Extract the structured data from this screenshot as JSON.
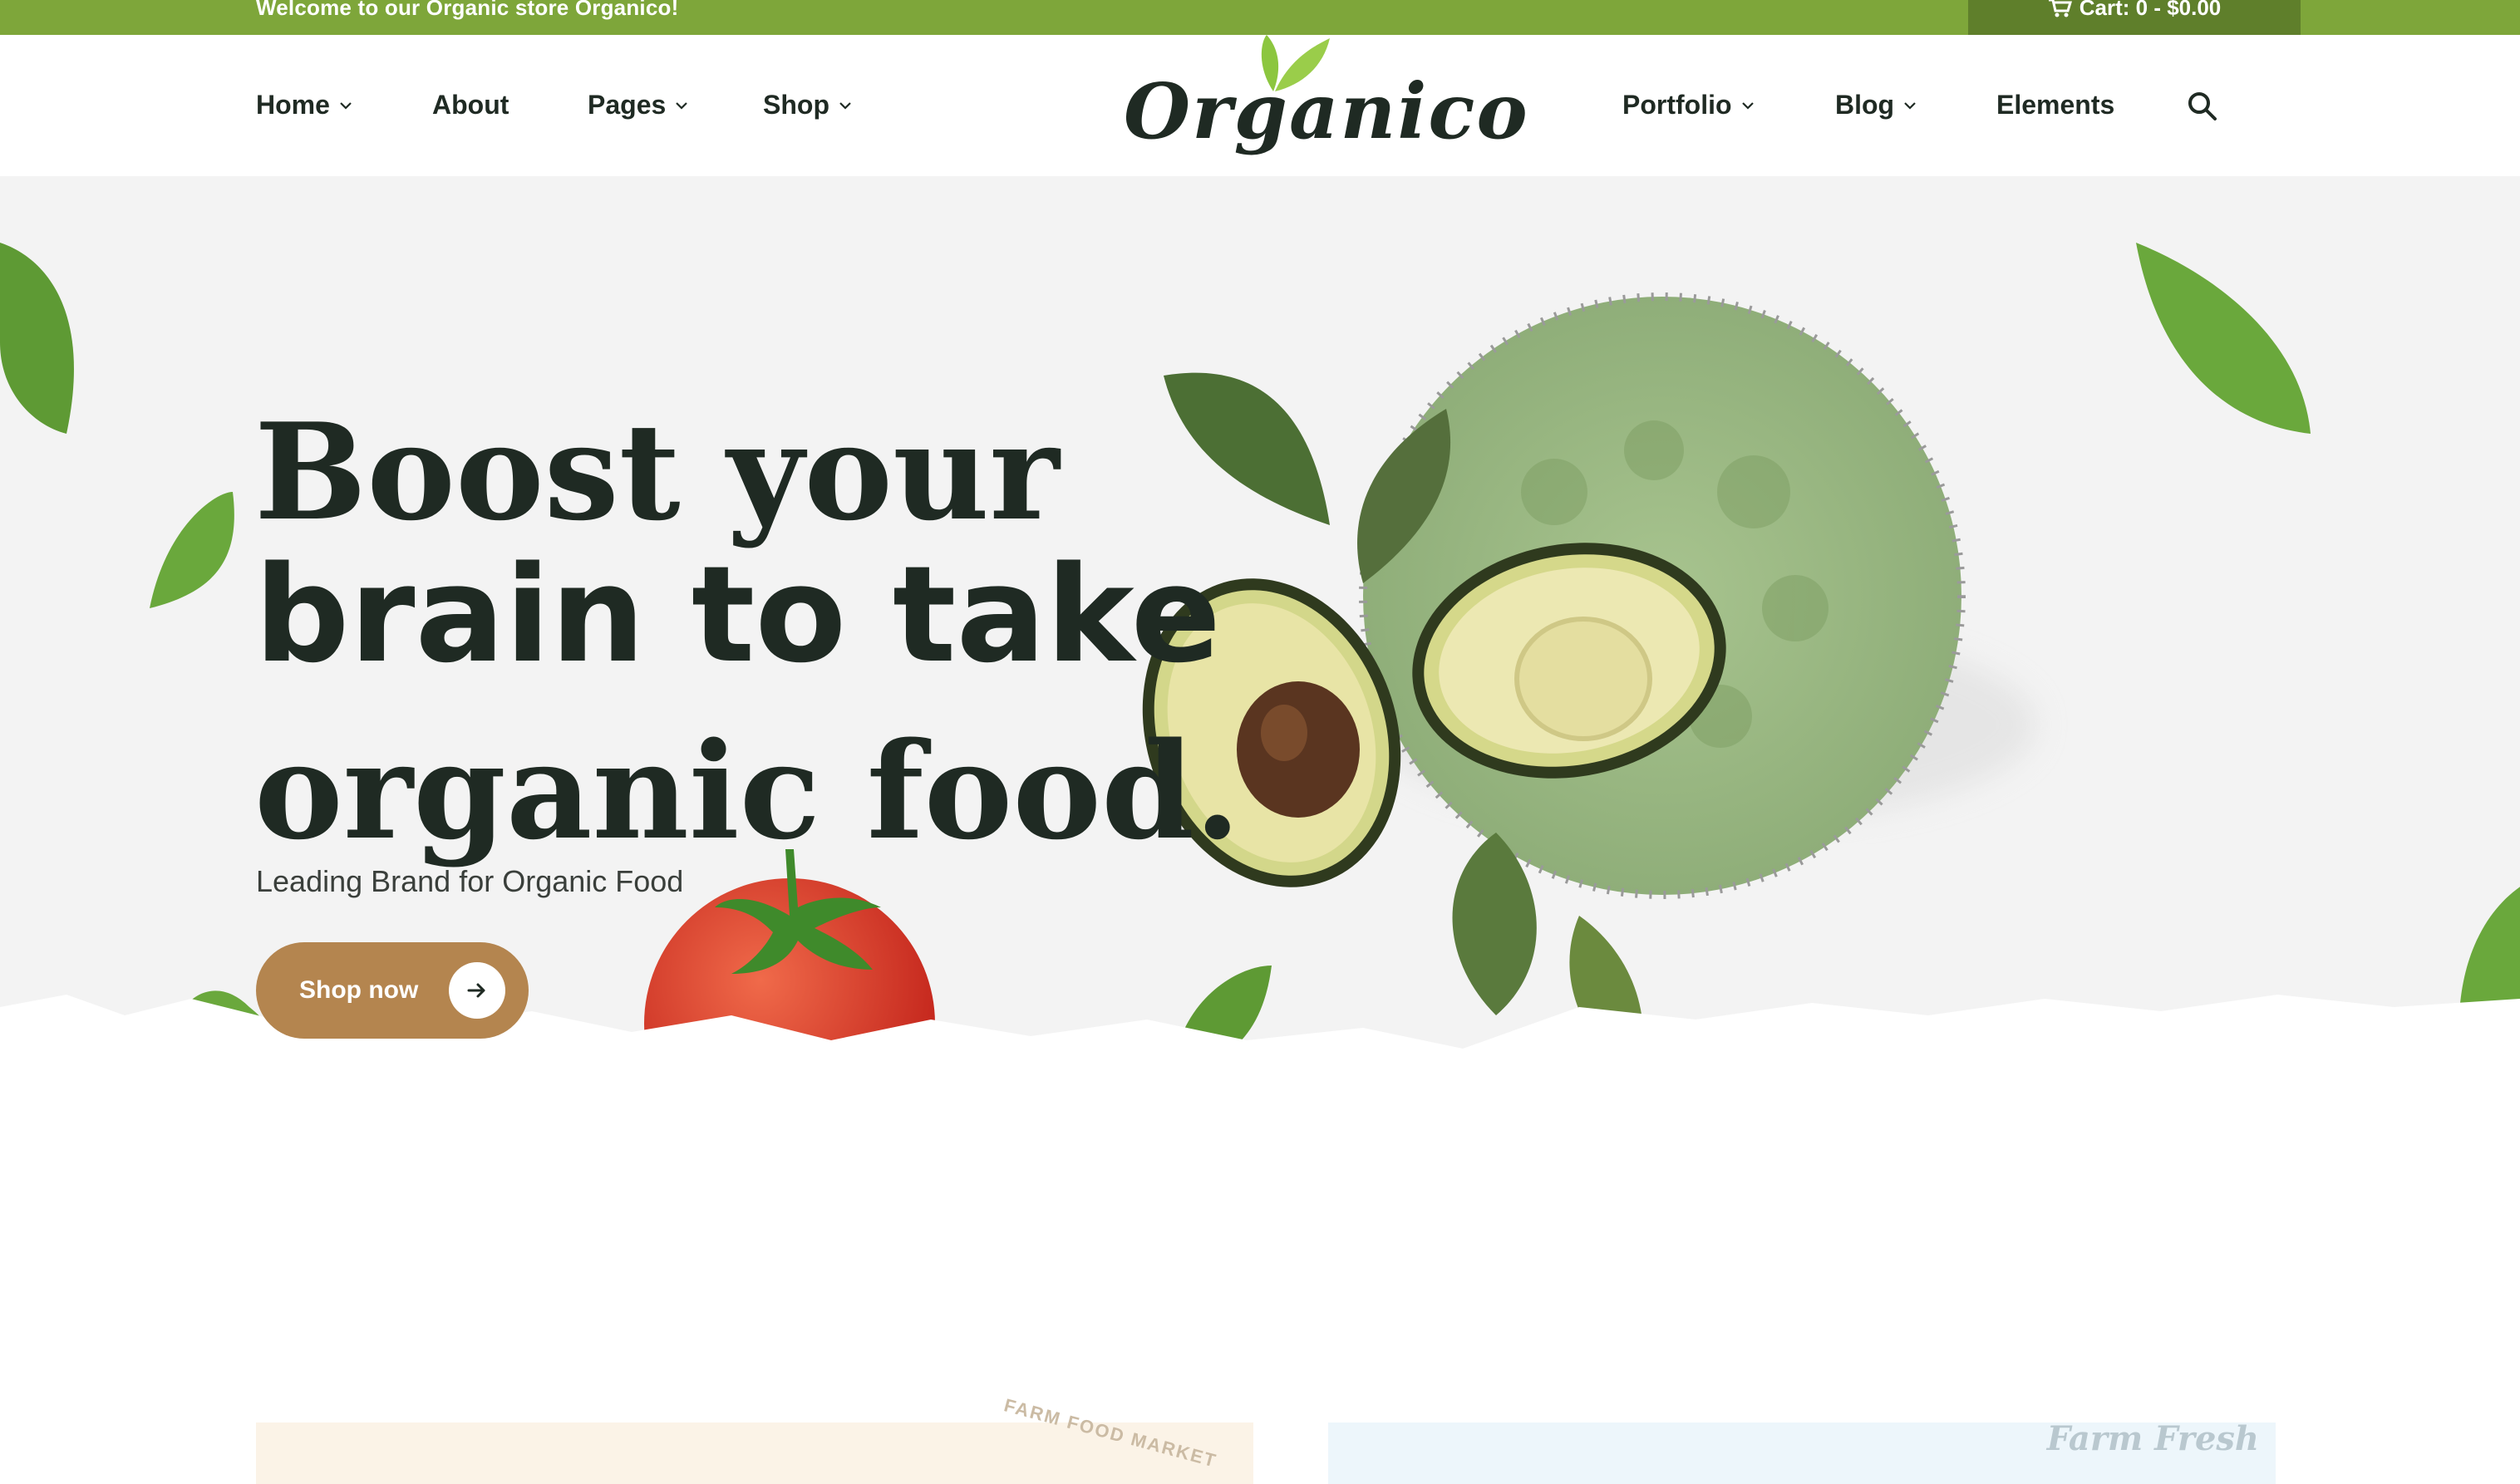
{
  "topbar": {
    "welcome": "Welcome to our Organic store Organico!",
    "cart": "Cart: 0 - $0.00",
    "color": "#7ea63a"
  },
  "nav": {
    "left_items": [
      {
        "label": "Home",
        "dropdown": true
      },
      {
        "label": "About",
        "dropdown": false
      },
      {
        "label": "Pages",
        "dropdown": true
      },
      {
        "label": "Shop",
        "dropdown": true
      }
    ],
    "logo": "Organico",
    "right_items": [
      {
        "label": "Portfolio",
        "dropdown": true
      },
      {
        "label": "Blog",
        "dropdown": true
      },
      {
        "label": "Elements",
        "dropdown": false
      }
    ],
    "search_icon": "search-icon"
  },
  "hero": {
    "headline_line1": "Boost your",
    "headline_line2": "brain  to take",
    "headline_line3": "organic food.",
    "subtitle": "Leading Brand for Organic Food",
    "cta_label": "Shop now",
    "cta_color": "#b4854f"
  },
  "cards": {
    "left_stamp": "FARM FOOD MARKET",
    "right_stamp": "Farm Fresh"
  }
}
